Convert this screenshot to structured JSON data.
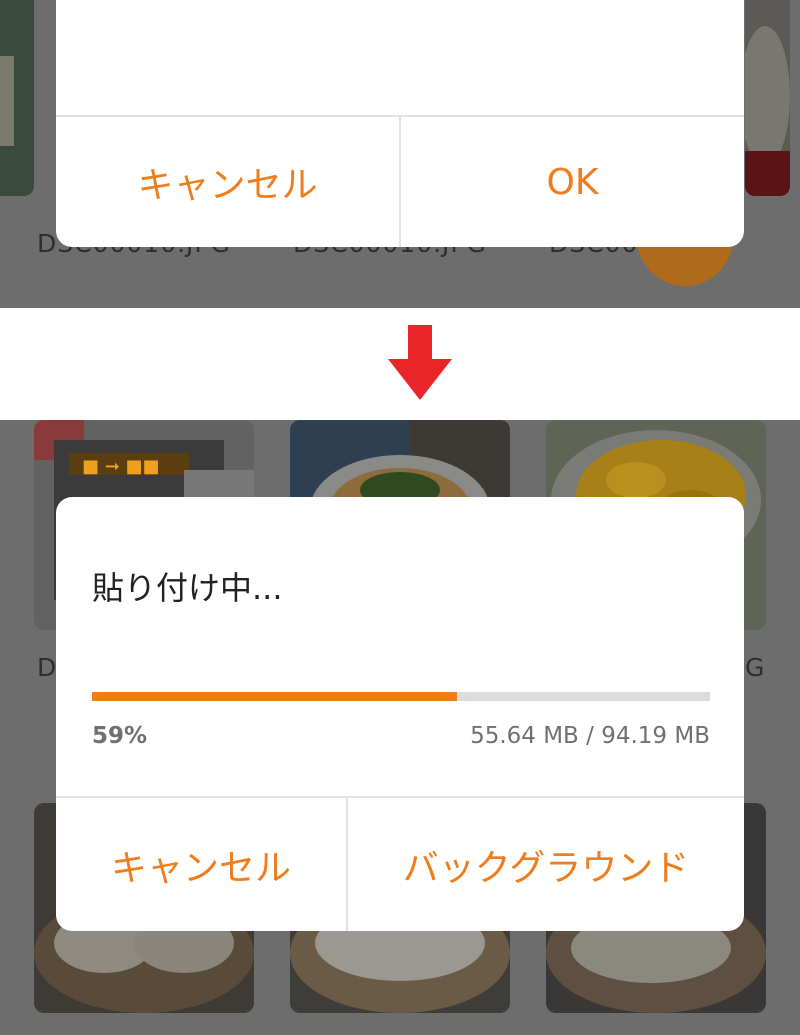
{
  "top_panel": {
    "filenames": [
      "DSC00010.JPG",
      "DSC00010.JPG",
      "DSC00 G"
    ],
    "dialog": {
      "cancel_label": "キャンセル",
      "ok_label": "OK"
    }
  },
  "transition_icon": "arrow-down-icon",
  "bottom_panel": {
    "filenames": [
      "D",
      "G"
    ],
    "dialog": {
      "title": "貼り付け中...",
      "progress_percent_value": 59,
      "progress_percent": "59%",
      "size_text": "55.64 MB / 94.19 MB",
      "cancel_label": "キャンセル",
      "background_label": "バックグラウンド"
    }
  },
  "colors": {
    "accent": "#ef7d1c",
    "arrow": "#e8262a",
    "overlay": "#6d6d6d",
    "progress_track": "#dcdcdc"
  }
}
